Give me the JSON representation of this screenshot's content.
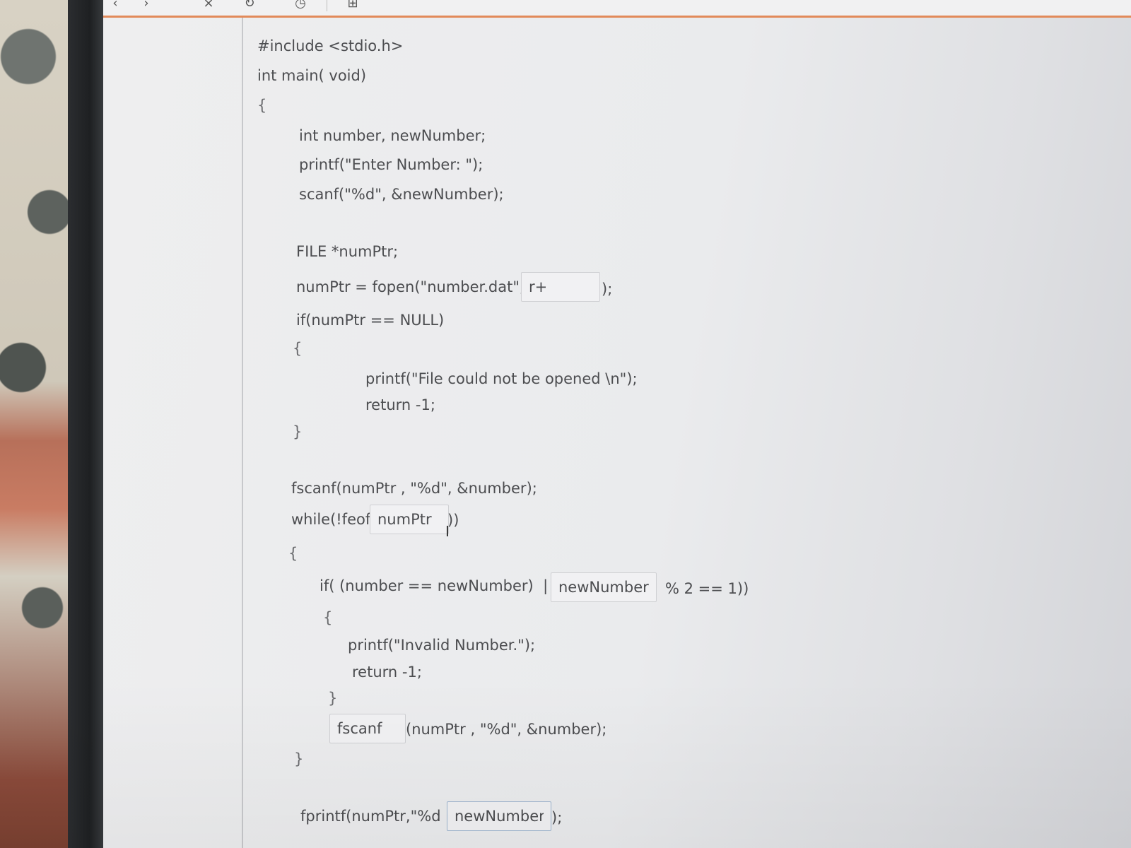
{
  "toolbar": {
    "icons": [
      "back-icon",
      "forward-icon",
      "close-icon",
      "refresh-icon",
      "clock-icon",
      "add-icon"
    ]
  },
  "code": {
    "l1": "#include <stdio.h>",
    "l2": "int main( void)",
    "l3": "{",
    "l4": "int number, newNumber;",
    "l5": "printf(\"Enter Number: \");",
    "l6": "scanf(\"%d\", &newNumber);",
    "l7": "FILE *numPtr;",
    "l8_pre": "numPtr = fopen(\"number.dat\",",
    "l8_post": ");",
    "l9": "if(numPtr == NULL)",
    "l10": "{",
    "l11": "printf(\"File could not be opened \\n\");",
    "l12": "return -1;",
    "l13": "}",
    "l14": "fscanf(numPtr , \"%d\", &number);",
    "l15_pre": "while(!feof(",
    "l15_post": "))",
    "l16": "{",
    "l17_pre": "if( (number == newNumber)  | | (",
    "l17_post": "% 2 == 1))",
    "l18": "{",
    "l19": "printf(\"Invalid Number.\");",
    "l20": "return -1;",
    "l21": "}",
    "l22_post": "(numPtr , \"%d\", &number);",
    "l23": "}",
    "l24_pre": "fprintf(numPtr,\"%d \",",
    "l24_post": ");"
  },
  "blanks": {
    "fopen_mode": "r+",
    "feof_arg": "numPtr",
    "modulo_operand": "newNumber",
    "read_function": "fscanf",
    "fprintf_arg": "newNumber"
  },
  "colors": {
    "accent": "#e28a5a",
    "text": "#4c4d50",
    "blank_border": "#cfd0d3"
  }
}
